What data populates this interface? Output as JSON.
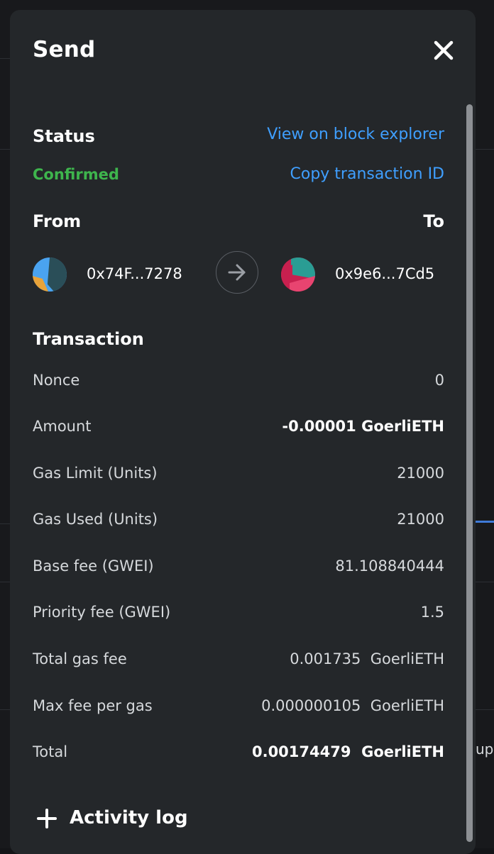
{
  "modal": {
    "title": "Send"
  },
  "status": {
    "label": "Status",
    "value": "Confirmed",
    "value_color": "#3eb54d",
    "view_explorer_link": "View on block explorer",
    "copy_tx_link": "Copy transaction ID",
    "link_color": "#3f9fff"
  },
  "parties": {
    "from_label": "From",
    "to_label": "To",
    "from_address": "0x74F...7278",
    "to_address": "0x9e6...7Cd5",
    "arrow_icon": "arrow-right-icon"
  },
  "transaction": {
    "heading": "Transaction",
    "rows": [
      {
        "label": "Nonce",
        "value": "0"
      },
      {
        "label": "Amount",
        "value": "-0.00001 GoerliETH"
      },
      {
        "label": "Gas Limit (Units)",
        "value": "21000"
      },
      {
        "label": "Gas Used (Units)",
        "value": "21000"
      },
      {
        "label": "Base fee (GWEI)",
        "value": "81.108840444"
      },
      {
        "label": "Priority fee (GWEI)",
        "value": "1.5"
      },
      {
        "label": "Total gas fee",
        "value": "0.001735  GoerliETH"
      },
      {
        "label": "Max fee per gas",
        "value": "0.000000105  GoerliETH"
      },
      {
        "label": "Total",
        "value": "0.00174479  GoerliETH"
      }
    ]
  },
  "activity_log": {
    "label": "Activity log",
    "icon": "plus-icon"
  },
  "background": {
    "partial_text": "up"
  }
}
